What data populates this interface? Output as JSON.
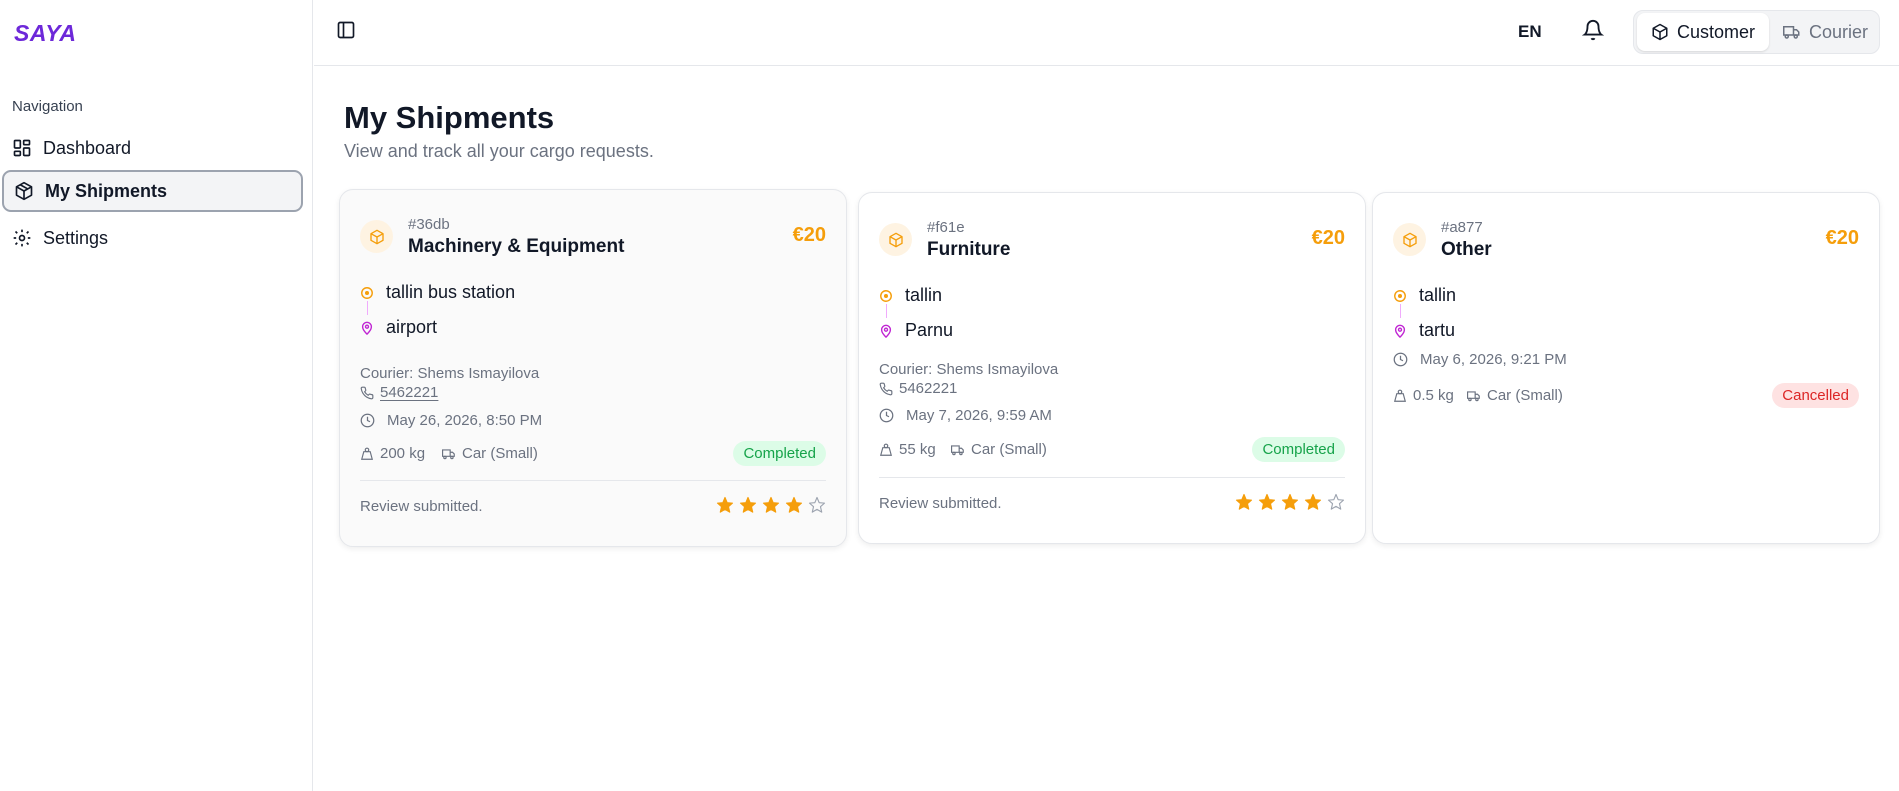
{
  "brand": {
    "logo": "SAYA"
  },
  "sidebar": {
    "section_title": "Navigation",
    "items": [
      {
        "label": "Dashboard",
        "icon": "dashboard-icon"
      },
      {
        "label": "My Shipments",
        "icon": "package-icon",
        "active": true
      },
      {
        "label": "Settings",
        "icon": "gear-icon"
      }
    ]
  },
  "topbar": {
    "language": "EN",
    "roles": [
      {
        "label": "Customer",
        "icon": "package-icon",
        "active": true
      },
      {
        "label": "Courier",
        "icon": "truck-icon",
        "active": false
      }
    ]
  },
  "page": {
    "title": "My Shipments",
    "subtitle": "View and track all your cargo requests."
  },
  "colors": {
    "brand": "#6d28d9",
    "price": "#f59e0b",
    "completed": "#16a34a",
    "cancelled": "#dc2626",
    "star": "#f59e0b"
  },
  "shipments": [
    {
      "id": "#36db",
      "category": "Machinery & Equipment",
      "price": "€20",
      "from": "tallin bus station",
      "to": "airport",
      "courier": "Courier: Shems Ismayilova",
      "phone": "5462221",
      "datetime": "May 26, 2026, 8:50 PM",
      "weight": "200 kg",
      "vehicle": "Car (Small)",
      "status": "Completed",
      "review": "Review submitted.",
      "rating": 4
    },
    {
      "id": "#f61e",
      "category": "Furniture",
      "price": "€20",
      "from": "tallin",
      "to": "Parnu",
      "courier": "Courier: Shems Ismayilova",
      "phone": "5462221",
      "datetime": "May 7, 2026, 9:59 AM",
      "weight": "55 kg",
      "vehicle": "Car (Small)",
      "status": "Completed",
      "review": "Review submitted.",
      "rating": 4
    },
    {
      "id": "#a877",
      "category": "Other",
      "price": "€20",
      "from": "tallin",
      "to": "tartu",
      "datetime": "May 6, 2026, 9:21 PM",
      "weight": "0.5 kg",
      "vehicle": "Car (Small)",
      "status": "Cancelled"
    }
  ]
}
